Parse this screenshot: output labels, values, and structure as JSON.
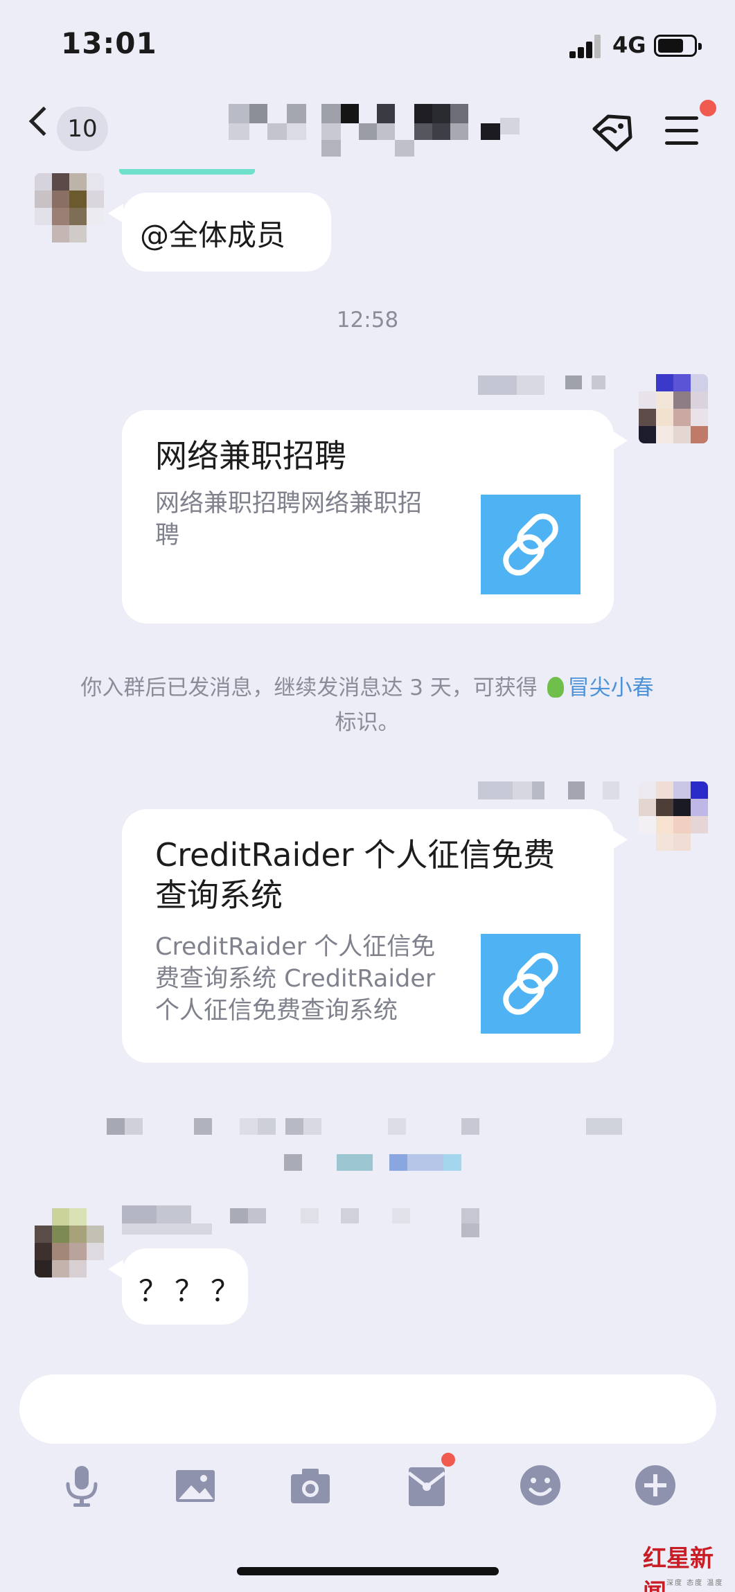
{
  "status_bar": {
    "time": "13:01",
    "network": "4G"
  },
  "nav": {
    "unread_count": "10"
  },
  "messages": {
    "at_all": "@全体成员",
    "timestamp": "12:58",
    "card1": {
      "title": "网络兼职招聘",
      "desc": "网络兼职招聘网络兼职招聘"
    },
    "notice": {
      "text_before": "你入群后已发消息，继续发消息达 3 天，可获得",
      "link": "冒尖小春",
      "text_after": "标识。"
    },
    "card2": {
      "title_line1": "CreditRaider 个人征信免费",
      "title_line2": "查询系统",
      "desc": "CreditRaider 个人征信免费查询系统 CreditRaider 个人征信免费查询系统"
    },
    "question": "？？？"
  },
  "toolbar": {
    "icons": [
      "microphone-icon",
      "image-icon",
      "camera-icon",
      "red-packet-icon",
      "emoji-icon",
      "plus-icon"
    ]
  },
  "watermark": {
    "brand": "红星新闻",
    "sub": "深度 态度 温度"
  },
  "colors": {
    "background": "#ecedf7",
    "link_thumb": "#4eb2f3",
    "badge": "#f05a4f",
    "link_text": "#4b92d8"
  }
}
